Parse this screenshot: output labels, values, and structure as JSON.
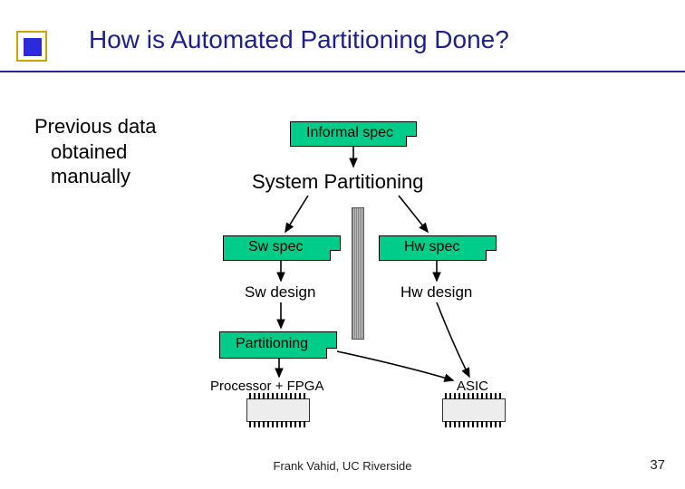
{
  "title": "How is Automated Partitioning Done?",
  "side_note": {
    "line1": "Previous data",
    "line2": "obtained",
    "line3": "manually"
  },
  "nodes": {
    "informal_spec": "Informal spec",
    "system_partitioning": "System Partitioning",
    "sw_spec": "Sw spec",
    "hw_spec": "Hw spec",
    "sw_design": "Sw design",
    "hw_design": "Hw design",
    "partitioning": "Partitioning",
    "processor_fpga": "Processor + FPGA",
    "asic": "ASIC"
  },
  "footer": "Frank Vahid, UC Riverside",
  "page": "37"
}
